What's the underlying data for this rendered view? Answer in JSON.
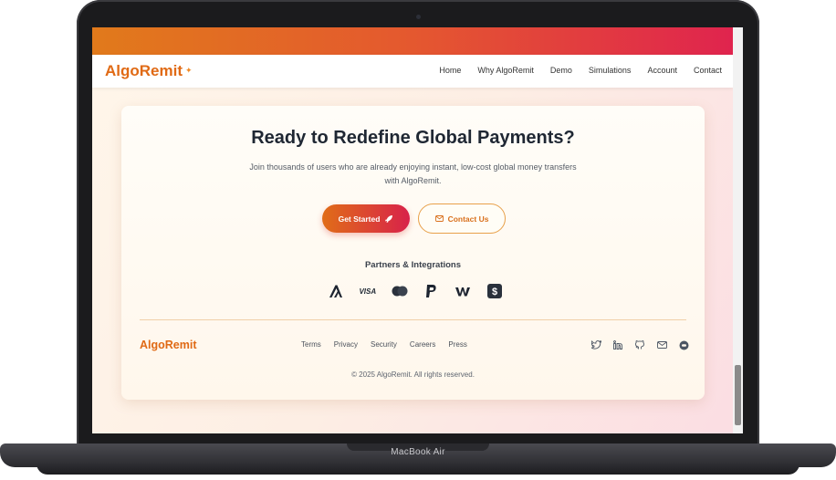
{
  "device": {
    "label": "MacBook Air"
  },
  "nav": {
    "logo": "AlgoRemit",
    "links": [
      "Home",
      "Why AlgoRemit",
      "Demo",
      "Simulations",
      "Account",
      "Contact"
    ]
  },
  "cta": {
    "headline": "Ready to Redefine Global Payments?",
    "subtext": "Join thousands of users who are already enjoying instant, low-cost global money transfers with AlgoRemit.",
    "primary_label": "Get Started",
    "secondary_label": "Contact Us"
  },
  "partners": {
    "title": "Partners & Integrations",
    "logos": [
      "algorand-icon",
      "visa-icon",
      "mastercard-icon",
      "paypal-icon",
      "wise-icon",
      "cashapp-icon"
    ],
    "visa_text": "VISA"
  },
  "footer": {
    "logo": "AlgoRemit",
    "links": [
      "Terms",
      "Privacy",
      "Security",
      "Careers",
      "Press"
    ],
    "social": [
      "twitter-icon",
      "linkedin-icon",
      "github-icon",
      "mail-icon",
      "discord-icon"
    ],
    "copyright": "© 2025 AlgoRemit. All rights reserved."
  },
  "colors": {
    "brand": "#e06a15",
    "gradient_start": "#e17a1b",
    "gradient_end": "#e0244e"
  }
}
